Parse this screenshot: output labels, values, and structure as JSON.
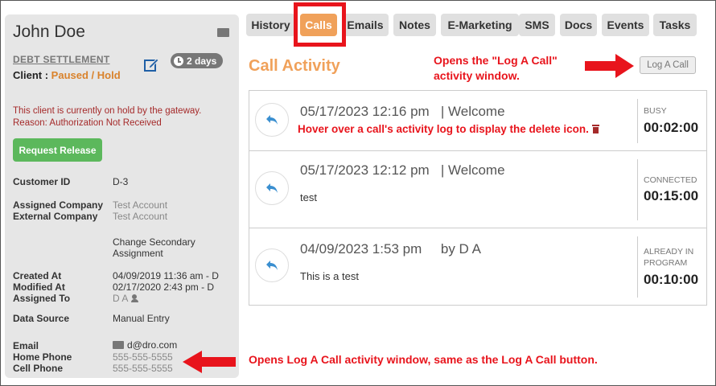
{
  "client": {
    "name": "John Doe",
    "program_link": "DEBT SETTLEMENT",
    "status_label": "Client : ",
    "status_value": "Paused / Hold",
    "days_badge": "2 days",
    "hold_message_line1": "This client is currently on hold by the gateway.",
    "hold_message_line2": "Reason: Authorization Not Received",
    "request_release": "Request Release"
  },
  "details": {
    "customer_id_label": "Customer ID",
    "customer_id": "D-3",
    "assigned_company_label": "Assigned Company",
    "assigned_company": "Test Account",
    "external_company_label": "External Company",
    "external_company": "Test Account",
    "change_secondary": "Change Secondary Assignment",
    "created_label": "Created At",
    "created": "04/09/2019 11:36 am - D",
    "modified_label": "Modified At",
    "modified": "02/17/2020 2:43 pm - D",
    "assigned_to_label": "Assigned To",
    "assigned_to": "D A",
    "data_source_label": "Data Source",
    "data_source": "Manual Entry",
    "email_label": "Email",
    "email": "d@dro.com",
    "home_phone_label": "Home Phone",
    "home_phone": "555-555-5555",
    "cell_phone_label": "Cell Phone",
    "cell_phone": "555-555-5555"
  },
  "tabs": [
    "History",
    "Calls",
    "Emails",
    "Notes",
    "E-Marketing",
    "SMS",
    "Docs",
    "Events",
    "Tasks"
  ],
  "active_tab": "Calls",
  "section_title": "Call Activity",
  "log_call_button": "Log A Call",
  "calls": [
    {
      "datetime": "05/17/2023 12:16 pm",
      "subject": "| Welcome",
      "note": "",
      "status": "BUSY",
      "duration": "00:02:00"
    },
    {
      "datetime": "05/17/2023 12:12 pm",
      "subject": "| Welcome",
      "note": "test",
      "status": "CONNECTED",
      "duration": "00:15:00"
    },
    {
      "datetime": "04/09/2023 1:53 pm",
      "subject": "by D A",
      "note": "This is a test",
      "status": "ALREADY IN PROGRAM",
      "duration": "00:10:00"
    }
  ],
  "annotations": {
    "log_call_line1": "Opens the \"Log A Call\"",
    "log_call_line2": "activity window.",
    "hover_delete": "Hover over a call's activity log to display the delete icon.",
    "phone_note": "Opens Log A Call activity window, same as the Log A Call button."
  },
  "colors": {
    "accent": "#f0a15a",
    "annotation": "#e8141c",
    "success": "#5cb85c",
    "hold_text": "#a52a2a",
    "edit_icon": "#1f5fa6",
    "reply_icon": "#3a8fd0"
  },
  "icons": [
    "envelope-icon",
    "edit-icon",
    "clock-icon",
    "reply-icon",
    "trash-icon",
    "assign-user-icon",
    "arrow-icon"
  ]
}
